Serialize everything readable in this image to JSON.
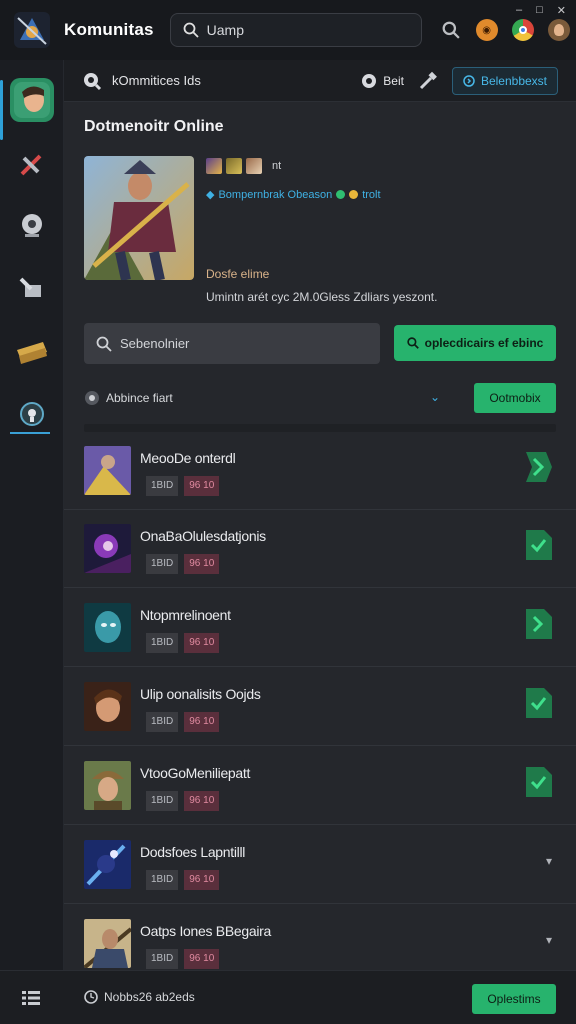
{
  "app": {
    "title": "Komunitas",
    "search_value": "Uamp",
    "window_controls": [
      "–",
      "□",
      "✕"
    ]
  },
  "subbar": {
    "breadcrumb": "kOmmitices Ids",
    "btn1_label": "Beit",
    "btn3_label": "Belenbbexst"
  },
  "hero": {
    "section_title": "Dotmenoitr Online",
    "thumb_note": "nt",
    "status_text": "Bompernbrak Obeason",
    "status_suffix": "trolt",
    "label": "Dosfe elime",
    "description": "Umintn arét cyc 2M.0Gless Zdliars yeszont."
  },
  "controls": {
    "search_placeholder": "Sebenolnier",
    "primary_button": "oplecdicairs ef ebinc",
    "filter_label": "Abbince fiart",
    "filter_button": "Ootmobix"
  },
  "rows": [
    {
      "title": "MeooDe onterdl",
      "tag_a": "1BID",
      "tag_b": "96 10",
      "action": "arrow"
    },
    {
      "title": "OnaBaOlulesdatjonis",
      "tag_a": "1BID",
      "tag_b": "96 10",
      "action": "check"
    },
    {
      "title": "Ntopmrelinoent",
      "tag_a": "1BID",
      "tag_b": "96 10",
      "action": "arrow"
    },
    {
      "title": "Ulip oonalisits Oojds",
      "tag_a": "1BID",
      "tag_b": "96 10",
      "action": "check"
    },
    {
      "title": "VtooGoMeniliepatt",
      "tag_a": "1BID",
      "tag_b": "96 10",
      "action": "check"
    },
    {
      "title": "Dodsfoes Lapntilll",
      "tag_a": "1BID",
      "tag_b": "96 10",
      "action": "chevron"
    },
    {
      "title": "Oatps Iones BBegaira",
      "tag_a": "1BID",
      "tag_b": "96 10",
      "action": "chevron"
    }
  ],
  "bottombar": {
    "status": "Nobbs26 ab2eds",
    "button": "Oplestims"
  },
  "colors": {
    "accent_green": "#27b36d",
    "accent_blue": "#3fb1e4",
    "background": "#25272c"
  }
}
